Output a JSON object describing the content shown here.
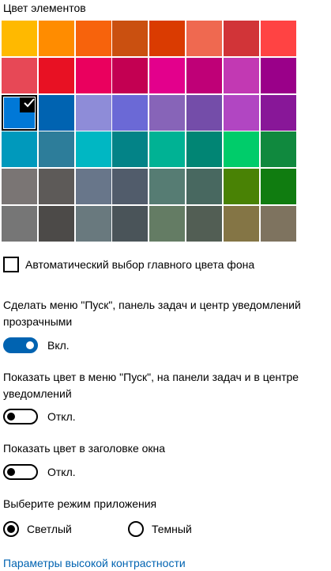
{
  "section_title": "Цвет элементов",
  "palette": {
    "colors": [
      "#FFB900",
      "#FF8C00",
      "#F7630C",
      "#CA5010",
      "#DA3B01",
      "#EF6950",
      "#D13438",
      "#FF4343",
      "#E74856",
      "#E81123",
      "#EA005E",
      "#C30052",
      "#E3008C",
      "#BF0077",
      "#C239B3",
      "#9A0089",
      "#0078D7",
      "#0063B1",
      "#8E8CD8",
      "#6B69D6",
      "#8764B8",
      "#744DA9",
      "#B146C2",
      "#881798",
      "#0099BC",
      "#2D7D9A",
      "#00B7C3",
      "#038387",
      "#00B294",
      "#018574",
      "#00CC6A",
      "#10893E",
      "#7A7574",
      "#5D5A58",
      "#68768A",
      "#515C6B",
      "#567C73",
      "#486860",
      "#498205",
      "#107C10",
      "#767676",
      "#4C4A48",
      "#69797E",
      "#4A5459",
      "#647C64",
      "#525E54",
      "#847545",
      "#7E735F"
    ],
    "selected_index": 16,
    "check_glyph": "check-icon"
  },
  "auto_color": {
    "label": "Автоматический выбор главного цвета фона",
    "checked": false
  },
  "transparency": {
    "label": "Сделать меню \"Пуск\", панель задач и центр уведомлений прозрачными",
    "state": "Вкл.",
    "on": true
  },
  "show_color_start": {
    "label": "Показать цвет в меню \"Пуск\", на панели задач и в центре уведомлений",
    "state": "Откл.",
    "on": false
  },
  "show_color_titlebar": {
    "label": "Показать цвет в заголовке окна",
    "state": "Откл.",
    "on": false
  },
  "app_mode": {
    "label": "Выберите режим приложения",
    "options": [
      "Светлый",
      "Темный"
    ],
    "selected": "Светлый"
  },
  "high_contrast_link": "Параметры высокой контрастности",
  "accent_color": "#0063B1"
}
